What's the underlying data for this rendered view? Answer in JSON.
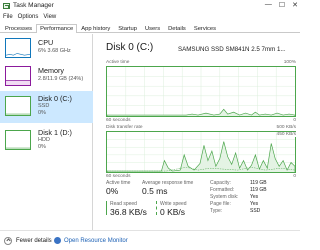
{
  "window": {
    "title": "Task Manager",
    "controls": {
      "minimize": "—",
      "maximize": "☐",
      "close": "✕"
    }
  },
  "menu": {
    "items": [
      "File",
      "Options",
      "View"
    ]
  },
  "tabs": [
    {
      "label": "Processes",
      "active": false
    },
    {
      "label": "Performance",
      "active": true
    },
    {
      "label": "App history",
      "active": false
    },
    {
      "label": "Startup",
      "active": false
    },
    {
      "label": "Users",
      "active": false
    },
    {
      "label": "Details",
      "active": false
    },
    {
      "label": "Services",
      "active": false
    }
  ],
  "sidebar": {
    "items": [
      {
        "name": "CPU",
        "line1": "6%  3.68 GHz",
        "line2": "",
        "color": "#1177bb",
        "selected": false
      },
      {
        "name": "Memory",
        "line1": "2.8/11.9 GB (24%)",
        "line2": "",
        "color": "#8b1a9c",
        "selected": false
      },
      {
        "name": "Disk 0 (C:)",
        "line1": "SSD",
        "line2": "0%",
        "color": "#4ca64c",
        "selected": true
      },
      {
        "name": "Disk 1 (D:)",
        "line1": "HDD",
        "line2": "0%",
        "color": "#4ca64c",
        "selected": false
      }
    ]
  },
  "main": {
    "title": "Disk 0 (C:)",
    "model": "SAMSUNG SSD SM841N 2.5 7mm 1...",
    "graph1": {
      "label": "Active time",
      "max": "100%",
      "left": "60 seconds",
      "right": "0"
    },
    "graph2": {
      "label": "Disk transfer rate",
      "max": "500 KB/s",
      "mid": "450 KB/s",
      "left": "60 seconds",
      "right": "0"
    },
    "stats": {
      "active_time_label": "Active time",
      "active_time": "0%",
      "response_label": "Average response time",
      "response": "0.5 ms",
      "read_label": "Read speed",
      "read": "36.8 KB/s",
      "write_label": "Write speed",
      "write": "0 KB/s",
      "read_color": "#4ca64c",
      "write_color": "#4ca64c"
    },
    "properties": [
      {
        "key": "Capacity:",
        "value": "119 GB"
      },
      {
        "key": "Formatted:",
        "value": "119 GB"
      },
      {
        "key": "System disk:",
        "value": "Yes"
      },
      {
        "key": "Page file:",
        "value": "Yes"
      },
      {
        "key": "Type:",
        "value": "SSD"
      }
    ]
  },
  "footer": {
    "fewer_details": "Fewer details",
    "open_resource_monitor": "Open Resource Monitor"
  },
  "colors": {
    "accent": "#4ca64c",
    "selection": "#cce8ff",
    "link": "#1a5fb4"
  }
}
